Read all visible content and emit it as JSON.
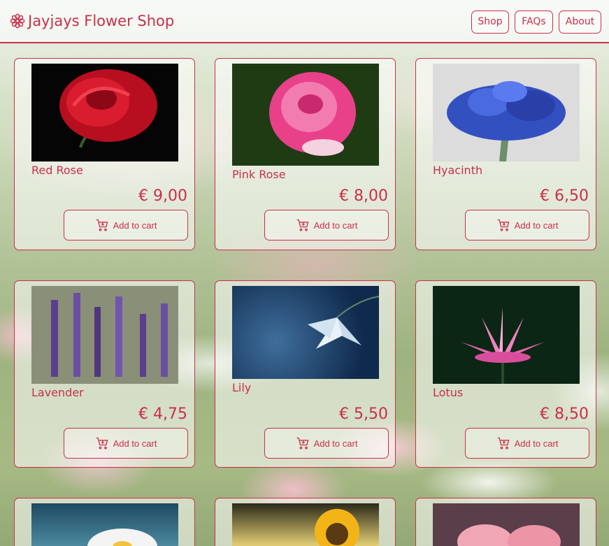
{
  "header": {
    "brand": "Jayjays Flower Shop",
    "nav": [
      {
        "label": "Shop"
      },
      {
        "label": "FAQs"
      },
      {
        "label": "About"
      }
    ]
  },
  "products": [
    {
      "name": "Red Rose",
      "price": "€ 9,00",
      "cart_label": "Add to cart"
    },
    {
      "name": "Pink Rose",
      "price": "€ 8,00",
      "cart_label": "Add to cart"
    },
    {
      "name": "Hyacinth",
      "price": "€ 6,50",
      "cart_label": "Add to cart"
    },
    {
      "name": "Lavender",
      "price": "€ 4,75",
      "cart_label": "Add to cart"
    },
    {
      "name": "Lily",
      "price": "€ 5,50",
      "cart_label": "Add to cart"
    },
    {
      "name": "Lotus",
      "price": "€ 8,50",
      "cart_label": "Add to cart"
    }
  ],
  "colors": {
    "accent": "#c8304a"
  }
}
